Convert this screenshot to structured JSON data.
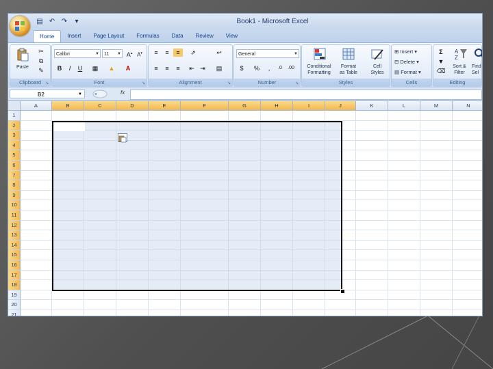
{
  "window": {
    "title": "Book1 - Microsoft Excel",
    "qat": [
      "save-icon",
      "undo-icon",
      "redo-icon",
      "customize-icon"
    ]
  },
  "tabs": [
    "Home",
    "Insert",
    "Page Layout",
    "Formulas",
    "Data",
    "Review",
    "View"
  ],
  "active_tab": "Home",
  "ribbon": {
    "clipboard": {
      "paste": "Paste",
      "label": "Clipboard"
    },
    "font": {
      "name": "Calibri",
      "size": "11",
      "bold": "B",
      "italic": "I",
      "underline": "U",
      "label": "Font"
    },
    "alignment": {
      "label": "Alignment"
    },
    "number": {
      "format": "General",
      "currency": "$",
      "percent": "%",
      "comma": ",",
      "label": "Number"
    },
    "styles": {
      "conditional": [
        "Conditional",
        "Formatting"
      ],
      "format_table": [
        "Format",
        "as Table"
      ],
      "cell_styles": [
        "Cell",
        "Styles"
      ],
      "label": "Styles"
    },
    "cells": {
      "insert": "Insert",
      "delete": "Delete",
      "format": "Format",
      "label": "Cells"
    },
    "editing": {
      "sum": "Σ",
      "sort": [
        "Sort &",
        "Filter"
      ],
      "find": [
        "Find",
        "Sel"
      ],
      "label": "Editing"
    }
  },
  "formula_bar": {
    "name_box": "B2",
    "fx": "fx",
    "content": ""
  },
  "columns": [
    "A",
    "B",
    "C",
    "D",
    "E",
    "F",
    "G",
    "H",
    "I",
    "J",
    "K",
    "L",
    "M",
    "N"
  ],
  "selected_columns": [
    "B",
    "C",
    "D",
    "E",
    "F",
    "G",
    "H",
    "I",
    "J"
  ],
  "rows": [
    "1",
    "2",
    "3",
    "4",
    "5",
    "6",
    "7",
    "8",
    "9",
    "10",
    "11",
    "12",
    "13",
    "14",
    "15",
    "16",
    "17",
    "18",
    "19",
    "20",
    "21"
  ],
  "selected_rows": [
    "2",
    "3",
    "4",
    "5",
    "6",
    "7",
    "8",
    "9",
    "10",
    "11",
    "12",
    "13",
    "14",
    "15",
    "16",
    "17",
    "18"
  ],
  "selection_range": "B2:J18",
  "colors": {
    "accent": "#f4b850",
    "ribbon": "#dbe7f6",
    "selection": "#c8d4eb",
    "slide_bg": "#5a5a5a"
  }
}
